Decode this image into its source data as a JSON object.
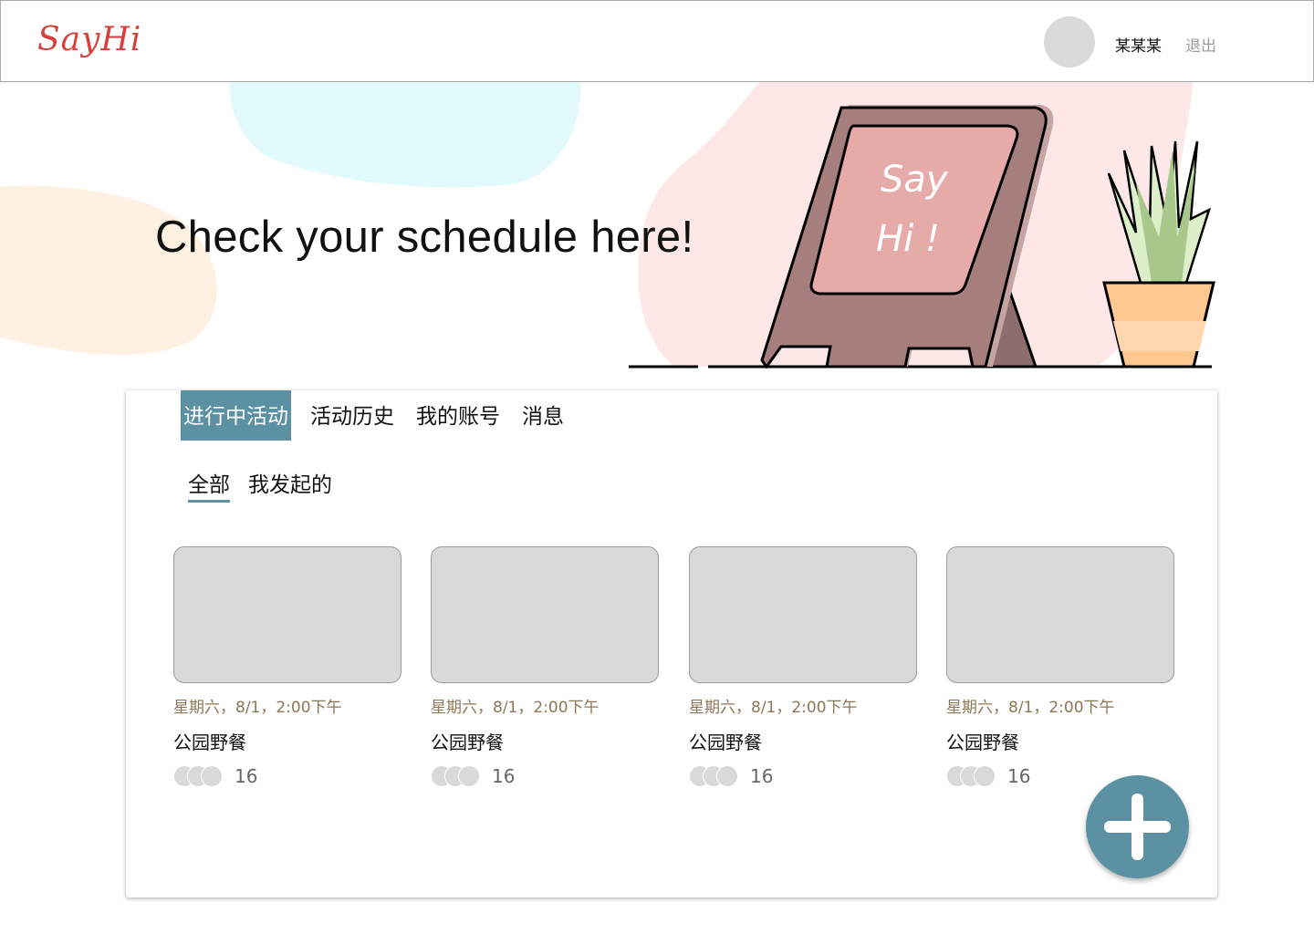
{
  "header": {
    "logo": "SayHi",
    "username": "某某某",
    "logout_label": "退出"
  },
  "hero": {
    "title": "Check your schedule here!",
    "sign_text_line1": "Say",
    "sign_text_line2": "Hi !"
  },
  "tabs": [
    {
      "label": "进行中活动",
      "active": true
    },
    {
      "label": "活动历史",
      "active": false
    },
    {
      "label": "我的账号",
      "active": false
    },
    {
      "label": "消息",
      "active": false
    }
  ],
  "subtabs": [
    {
      "label": "全部",
      "active": true
    },
    {
      "label": "我发起的",
      "active": false
    }
  ],
  "cards": [
    {
      "date": "星期六，8/1，2:00下午",
      "title": "公园野餐",
      "count": "16"
    },
    {
      "date": "星期六，8/1，2:00下午",
      "title": "公园野餐",
      "count": "16"
    },
    {
      "date": "星期六，8/1，2:00下午",
      "title": "公园野餐",
      "count": "16"
    },
    {
      "date": "星期六，8/1，2:00下午",
      "title": "公园野餐",
      "count": "16"
    }
  ],
  "colors": {
    "accent": "#5b91a3",
    "logo": "#d6403d",
    "date_text": "#8d7658",
    "placeholder": "#d9d9d9"
  },
  "icons": {
    "add_button": "plus-icon",
    "decoration_sign": "easel-sign-illustration",
    "decoration_plant": "potted-plant-illustration"
  }
}
